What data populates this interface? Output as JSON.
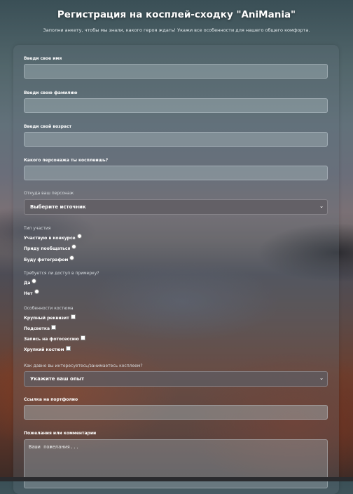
{
  "header": {
    "title": "Регистрация на косплей-сходку \"AniMania\"",
    "subtitle": "Заполни анкету, чтобы мы знали, какого героя ждать! Укажи все особенности для нашего общего комфорта."
  },
  "form": {
    "first_name_label": "Введи свое имя",
    "last_name_label": "Введи свою фамилию",
    "age_label": "Введи свой возраст",
    "character_label": "Какого персонажа ты косплеишь?",
    "source_label": "Откуда ваш персонаж",
    "source_select": "Выберите источник",
    "participation_label": "Тип участия",
    "participation_options": [
      "Участвую в конкурсе",
      "Приду пообщаться",
      "Буду фотографом"
    ],
    "dressing_label": "Требуется ли доступ в примерку?",
    "dressing_options": [
      "Да",
      "Нет"
    ],
    "costume_label": "Особенности костюма",
    "costume_options": [
      "Крупный реквизит",
      "Подсветка",
      "Запись на фотосессию",
      "Хрупкий костюм"
    ],
    "experience_label": "Как давно вы интересуетесь/занимаетесь косплеем?",
    "experience_select": "Укажите ваш опыт",
    "portfolio_label": "Ссылка на портфолио",
    "comments_label": "Пожелания или комментарии",
    "comments_placeholder": "Ваши пожелания..."
  }
}
